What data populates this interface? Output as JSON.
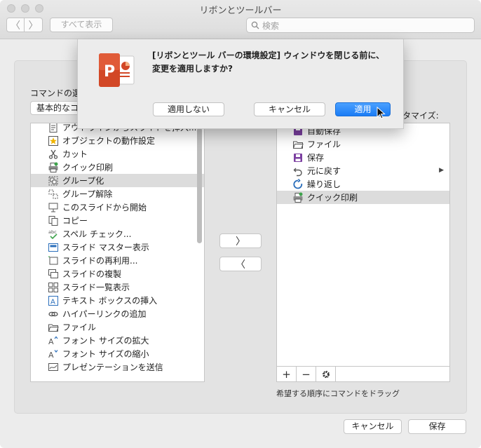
{
  "window": {
    "title": "リボンとツールバー",
    "nav_back": "〈",
    "nav_forward": "〉",
    "show_all": "すべて表示",
    "search_placeholder": "検索"
  },
  "commands": {
    "label": "コマンドの選",
    "category": "基本的なコ",
    "items": [
      {
        "label": "アウトラインからスライドを挿入...",
        "icon": "outline-insert-icon"
      },
      {
        "label": "オブジェクトの動作設定",
        "icon": "star-action-icon"
      },
      {
        "label": "カット",
        "icon": "scissors-icon"
      },
      {
        "label": "クイック印刷",
        "icon": "printer-icon"
      },
      {
        "label": "グループ化",
        "icon": "group-icon",
        "selected": true
      },
      {
        "label": "グループ解除",
        "icon": "ungroup-icon"
      },
      {
        "label": "このスライドから開始",
        "icon": "presentation-screen-icon"
      },
      {
        "label": "コピー",
        "icon": "copy-icon"
      },
      {
        "label": "スペル チェック...",
        "icon": "spellcheck-icon"
      },
      {
        "label": "スライド マスター表示",
        "icon": "slide-master-icon"
      },
      {
        "label": "スライドの再利用...",
        "icon": "reuse-slide-icon"
      },
      {
        "label": "スライドの複製",
        "icon": "duplicate-slide-icon"
      },
      {
        "label": "スライド一覧表示",
        "icon": "slide-sorter-icon"
      },
      {
        "label": "テキスト ボックスの挿入",
        "icon": "textbox-icon"
      },
      {
        "label": "ハイパーリンクの追加",
        "icon": "link-icon"
      },
      {
        "label": "ファイル",
        "icon": "folder-icon"
      },
      {
        "label": "フォント サイズの拡大",
        "icon": "font-grow-icon"
      },
      {
        "label": "フォント サイズの縮小",
        "icon": "font-shrink-icon"
      },
      {
        "label": "プレゼンテーションを送信",
        "icon": "send-icon"
      }
    ]
  },
  "toolbar_customize": {
    "label": "スタマイズ:",
    "items": [
      {
        "label": "自動保存",
        "icon": "autosave-icon"
      },
      {
        "label": "ファイル",
        "icon": "folder-icon"
      },
      {
        "label": "保存",
        "icon": "save-icon"
      },
      {
        "label": "元に戻す",
        "icon": "undo-icon",
        "submenu": true
      },
      {
        "label": "繰り返し",
        "icon": "redo-icon"
      },
      {
        "label": "クイック印刷",
        "icon": "printer-icon",
        "selected": true
      }
    ],
    "add_symbol": "+",
    "remove_symbol": "−",
    "hint": "希望する順序にコマンドをドラッグ"
  },
  "transfer": {
    "add_arrow": "〉",
    "remove_arrow": "〈"
  },
  "footer": {
    "cancel": "キャンセル",
    "save": "保存"
  },
  "dialog": {
    "line1": "[リボンとツール バーの環境設定] ウィンドウを閉じる前に、",
    "line2": "変更を適用しますか?",
    "dont_apply": "適用しない",
    "cancel": "キャンセル",
    "apply": "適用",
    "app_icon": "powerpoint-icon",
    "accent": "#1a7cf5",
    "brand": "#d24726"
  }
}
